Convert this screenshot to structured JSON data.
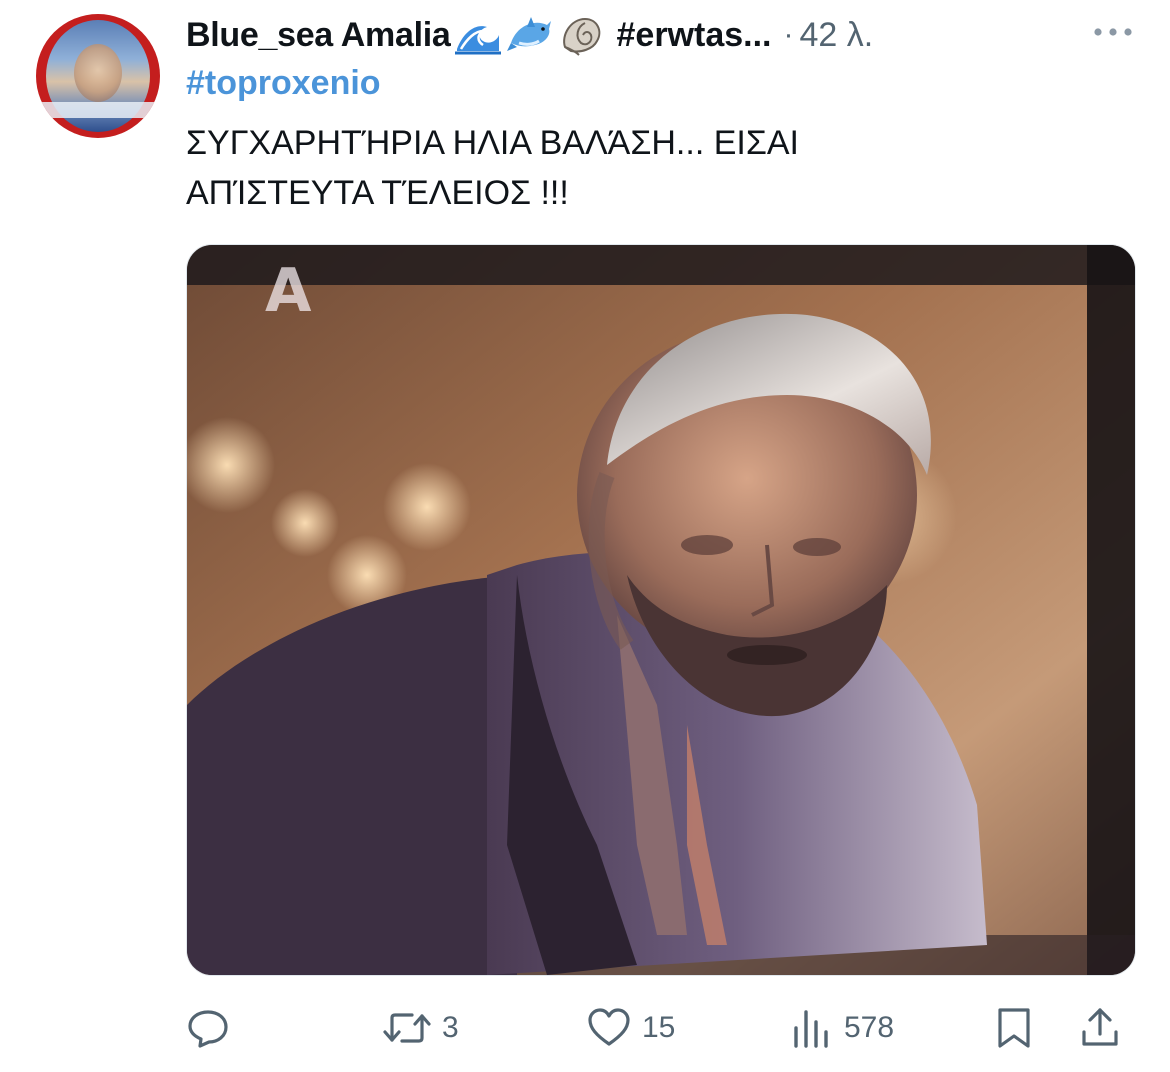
{
  "tweet": {
    "author": {
      "display_name": "Blue_sea Amalia",
      "name_emojis": [
        "wave-emoji",
        "dolphin-emoji",
        "shell-emoji"
      ],
      "handle": "#erwtas...",
      "separator": "·",
      "time": "42 λ."
    },
    "hashtag": "#toproxenio",
    "text_lines": [
      " ΣΥΓΧΑΡΗΤΉΡΙΑ ΗΛΙΑ ΒΑΛΆΣΗ... ΕΙΣΑΙ",
      "ΑΠΊΣΤΕΥΤΑ ΤΈΛΕΙΟΣ !!!"
    ],
    "media": {
      "type": "photo",
      "watermark": "A"
    },
    "actions": {
      "reply": {
        "icon": "reply-icon",
        "count": ""
      },
      "retweet": {
        "icon": "retweet-icon",
        "count": "3"
      },
      "like": {
        "icon": "heart-icon",
        "count": "15"
      },
      "views": {
        "icon": "views-icon",
        "count": "578"
      },
      "bookmark": {
        "icon": "bookmark-icon"
      },
      "share": {
        "icon": "share-icon"
      }
    }
  },
  "colors": {
    "text": "#0f1419",
    "muted": "#536471",
    "hashtag": "#4b94d9"
  }
}
